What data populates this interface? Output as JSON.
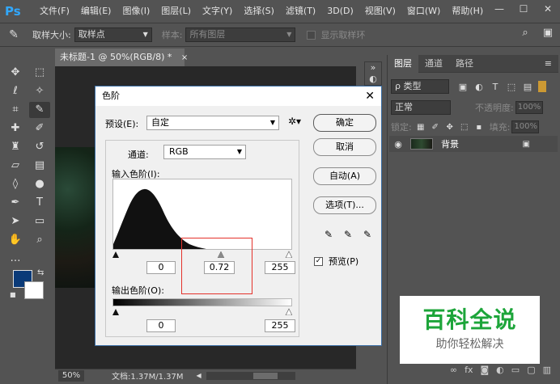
{
  "app": {
    "logo": "Ps",
    "menu": [
      "文件(F)",
      "编辑(E)",
      "图像(I)",
      "图层(L)",
      "文字(Y)",
      "选择(S)",
      "滤镜(T)",
      "3D(D)",
      "视图(V)",
      "窗口(W)",
      "帮助(H)"
    ],
    "window_controls": [
      "—",
      "☐",
      "✕"
    ]
  },
  "options_bar": {
    "tool_icon": "eyedropper-icon",
    "sample_size_label": "取样大小:",
    "sample_size_value": "取样点",
    "sample_label": "样本:",
    "sample_value": "所有图层",
    "show_ring_label": "显示取样环"
  },
  "toolbox": {
    "tools": [
      "move-icon",
      "marquee-icon",
      "lasso-icon",
      "magic-wand-icon",
      "crop-icon",
      "eyedropper-icon",
      "healing-icon",
      "brush-icon",
      "stamp-icon",
      "history-brush-icon",
      "eraser-icon",
      "gradient-icon",
      "blur-icon",
      "dodge-icon",
      "pen-icon",
      "type-icon",
      "path-select-icon",
      "shape-icon",
      "hand-icon",
      "zoom-icon"
    ],
    "foreground_color": "#0a3a78",
    "background_color": "#ffffff"
  },
  "document": {
    "tab_title": "未标题-1 @ 50%(RGB/8) *",
    "tab_close": "×",
    "zoom": "50%",
    "doc_info": "文档:1.37M/1.37M"
  },
  "layers_panel": {
    "tabs": [
      "图层",
      "通道",
      "路径"
    ],
    "kind": "ρ 类型",
    "blend_mode": "正常",
    "opacity_label": "不透明度:",
    "opacity_value": "100%",
    "lock_label": "锁定:",
    "fill_label": "填充:",
    "fill_value": "100%",
    "layer_name": "背景"
  },
  "levels_dialog": {
    "title": "色阶",
    "preset_label": "预设(E):",
    "preset_value": "自定",
    "channel_label": "通道:",
    "channel_value": "RGB",
    "input_label": "输入色阶(I):",
    "input_black": "0",
    "input_gamma": "0.72",
    "input_white": "255",
    "output_label": "输出色阶(O):",
    "output_black": "0",
    "output_white": "255",
    "buttons": {
      "ok": "确定",
      "cancel": "取消",
      "auto": "自动(A)",
      "options": "选项(T)..."
    },
    "preview_label": "预览(P)",
    "preview_checked": true
  },
  "watermark": {
    "title": "百科全说",
    "subtitle": "助你轻松解决"
  }
}
